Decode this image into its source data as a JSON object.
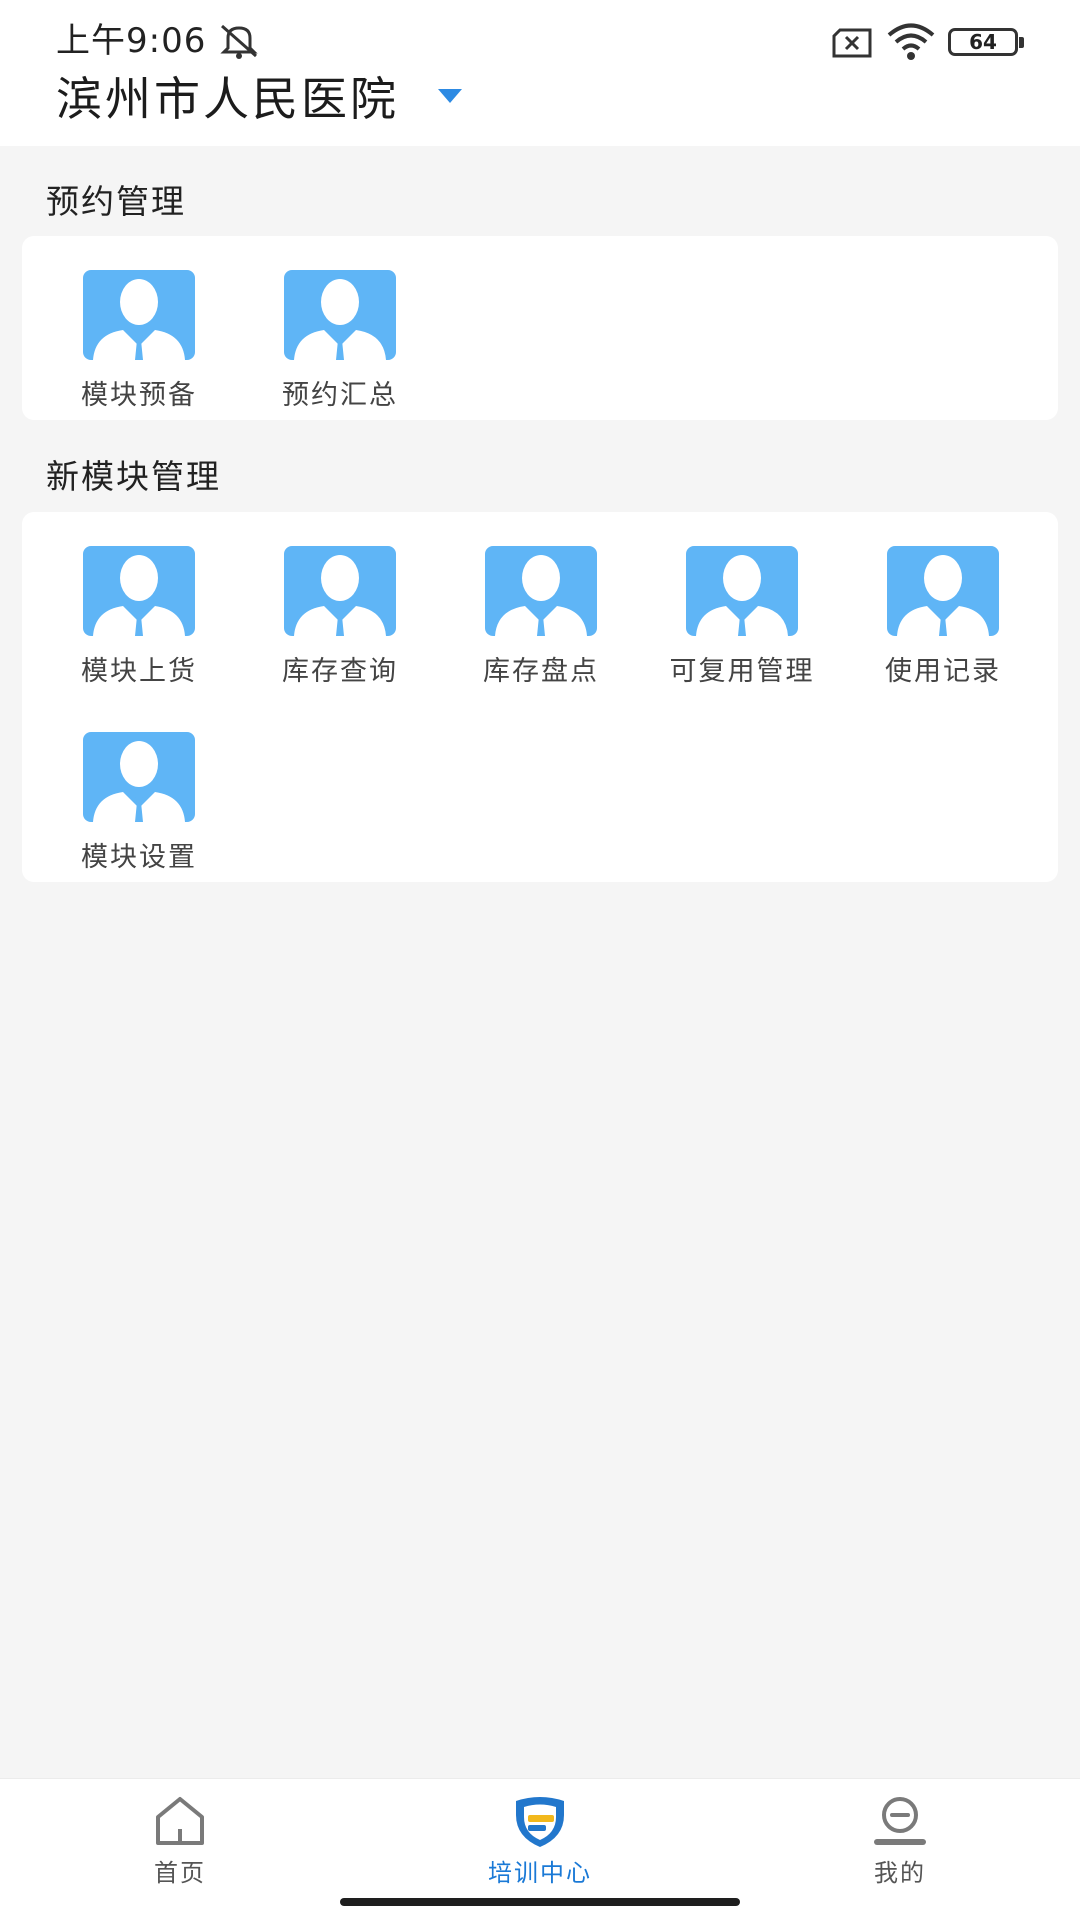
{
  "status_bar": {
    "time": "上午9:06",
    "battery_level": "64",
    "icons": [
      "mute-icon",
      "no-sim-icon",
      "wifi-icon",
      "battery-icon"
    ]
  },
  "header": {
    "title": "滨州市人民医院",
    "dropdown_icon": "caret-down-icon"
  },
  "sections": [
    {
      "title": "预约管理",
      "items": [
        {
          "label": "模块预备",
          "icon": "person-icon"
        },
        {
          "label": "预约汇总",
          "icon": "person-icon"
        }
      ]
    },
    {
      "title": "新模块管理",
      "items": [
        {
          "label": "模块上货",
          "icon": "person-icon"
        },
        {
          "label": "库存查询",
          "icon": "person-icon"
        },
        {
          "label": "库存盘点",
          "icon": "person-icon"
        },
        {
          "label": "可复用管理",
          "icon": "person-icon"
        },
        {
          "label": "使用记录",
          "icon": "person-icon"
        },
        {
          "label": "模块设置",
          "icon": "person-icon"
        }
      ]
    }
  ],
  "bottom_nav": {
    "items": [
      {
        "label": "首页",
        "icon": "home-icon",
        "active": false
      },
      {
        "label": "培训中心",
        "icon": "shield-icon",
        "active": true
      },
      {
        "label": "我的",
        "icon": "profile-icon",
        "active": false
      }
    ]
  },
  "colors": {
    "accent": "#1a79d6",
    "tile_icon_bg": "#5fb5f6",
    "page_bg": "#f5f5f5",
    "card_bg": "#ffffff"
  }
}
